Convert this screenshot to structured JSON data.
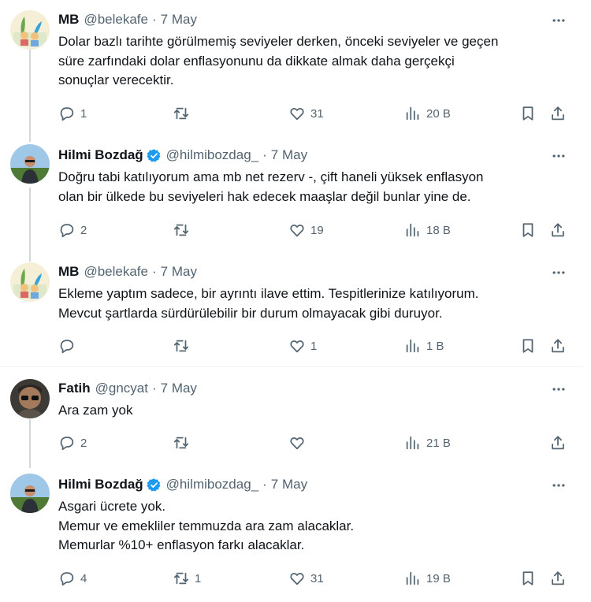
{
  "tweets": [
    {
      "name": "MB",
      "handle": "@belekafe",
      "dot": "·",
      "date": "7 May",
      "verified": false,
      "lines": [
        "Dolar bazlı tarihte görülmemiş seviyeler derken, önceki seviyeler ve geçen",
        "süre zarfındaki dolar enflasyonunu da dikkate almak daha gerçekçi",
        "sonuçlar verecektir."
      ],
      "replies": "1",
      "retweets": "",
      "likes": "31",
      "views": "20 B"
    },
    {
      "name": "Hilmi Bozdağ",
      "handle": "@hilmibozdag_",
      "dot": "·",
      "date": "7 May",
      "verified": true,
      "lines": [
        "Doğru tabi katılıyorum ama mb net rezerv -, çift haneli yüksek enflasyon",
        "olan bir ülkede bu seviyeleri hak edecek maaşlar değil bunlar yine de."
      ],
      "replies": "2",
      "retweets": "",
      "likes": "19",
      "views": "18 B"
    },
    {
      "name": "MB",
      "handle": "@belekafe",
      "dot": "·",
      "date": "7 May",
      "verified": false,
      "lines": [
        "Ekleme yaptım sadece, bir ayrıntı ilave ettim. Tespitlerinize katılıyorum.",
        "Mevcut şartlarda sürdürülebilir bir durum olmayacak gibi duruyor."
      ],
      "replies": "",
      "retweets": "",
      "likes": "1",
      "views": "1 B"
    },
    {
      "name": "Fatih",
      "handle": "@gncyat",
      "dot": "·",
      "date": "7 May",
      "verified": false,
      "lines": [
        "Ara zam yok"
      ],
      "replies": "2",
      "retweets": "",
      "likes": "",
      "views": "21 B"
    },
    {
      "name": "Hilmi Bozdağ",
      "handle": "@hilmibozdag_",
      "dot": "·",
      "date": "7 May",
      "verified": true,
      "lines": [
        "Asgari ücrete yok.",
        "Memur ve emekliler temmuzda ara zam alacaklar.",
        "Memurlar %10+ enflasyon farkı alacaklar."
      ],
      "replies": "4",
      "retweets": "1",
      "likes": "31",
      "views": "19 B"
    }
  ],
  "icons": {
    "reply": "reply-icon",
    "retweet": "retweet-icon",
    "like": "heart-icon",
    "views": "views-icon",
    "bookmark": "bookmark-icon",
    "share": "share-icon",
    "more": "more-icon"
  },
  "colors": {
    "verified": "#1d9bf0",
    "muted": "#536471",
    "text": "#0f1419",
    "divider": "#eff3f4",
    "thread_line": "#cfd9de"
  }
}
